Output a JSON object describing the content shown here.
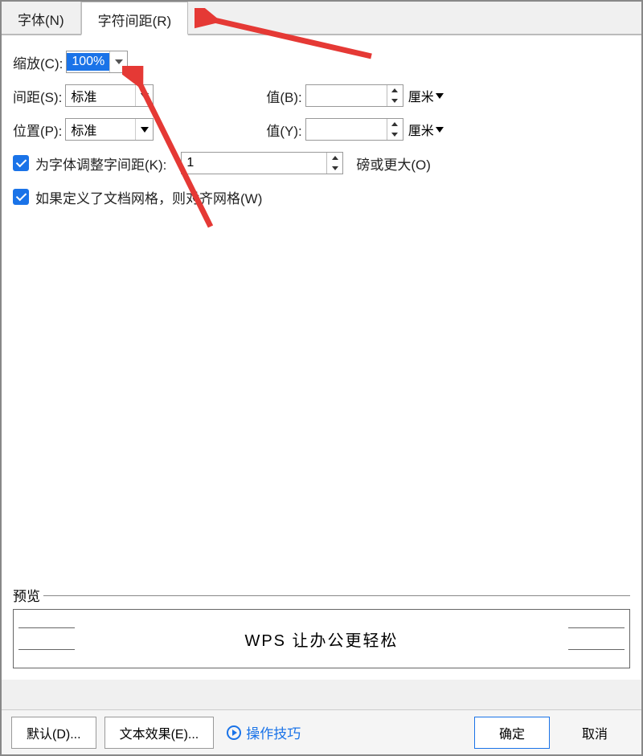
{
  "tabs": {
    "font": "字体(N)",
    "spacing": "字符间距(R)"
  },
  "fields": {
    "scale_label": "缩放(C):",
    "scale_value": "100%",
    "spacing_label": "间距(S):",
    "spacing_value": "标准",
    "value_b_label": "值(B):",
    "value_b_value": "",
    "unit_cm": "厘米",
    "position_label": "位置(P):",
    "position_value": "标准",
    "value_y_label": "值(Y):",
    "value_y_value": "",
    "kern_label": "为字体调整字间距(K):",
    "kern_value": "1",
    "kern_unit": "磅或更大(O)",
    "grid_label": "如果定义了文档网格，则对齐网格(W)"
  },
  "preview": {
    "group_label": "预览",
    "sample_text": "WPS 让办公更轻松"
  },
  "footer": {
    "default_btn": "默认(D)...",
    "text_effect_btn": "文本效果(E)...",
    "tips": "操作技巧",
    "ok": "确定",
    "cancel": "取消"
  }
}
